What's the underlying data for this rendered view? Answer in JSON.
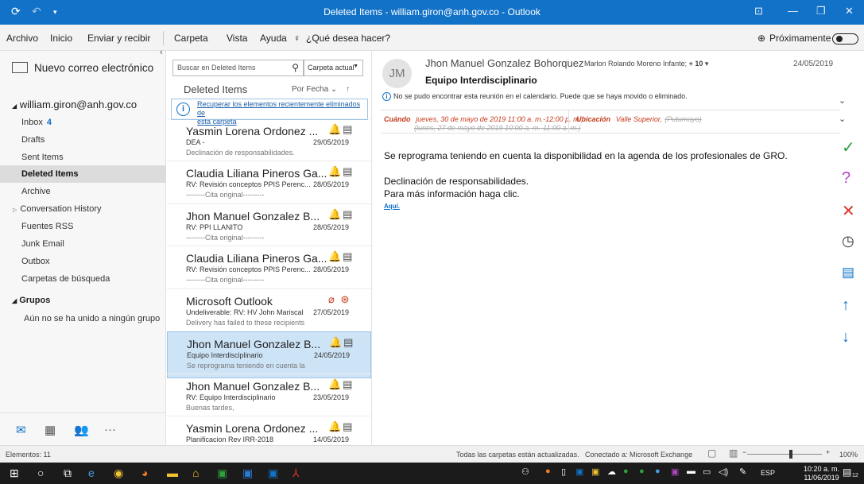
{
  "window": {
    "title": "Deleted Items - william.giron@anh.gov.co - Outlook"
  },
  "menu": {
    "items": [
      "Archivo",
      "Inicio",
      "Enviar y recibir",
      "Carpeta",
      "Vista",
      "Ayuda"
    ],
    "tell_me": "¿Qué desea hacer?",
    "coming_soon": "Próximamente"
  },
  "folders": {
    "new_mail": "Nuevo correo electrónico",
    "account": "william.giron@anh.gov.co",
    "items": [
      {
        "label": "Inbox",
        "count": "4"
      },
      {
        "label": "Drafts"
      },
      {
        "label": "Sent Items"
      },
      {
        "label": "Deleted Items"
      },
      {
        "label": "Archive"
      },
      {
        "label": "Conversation History"
      },
      {
        "label": "Fuentes RSS"
      },
      {
        "label": "Junk Email"
      },
      {
        "label": "Outbox"
      },
      {
        "label": "Carpetas de búsqueda"
      }
    ],
    "groups_label": "Grupos",
    "groups_empty": "Aún no se ha unido a ningún grupo"
  },
  "list": {
    "search_placeholder": "Buscar en Deleted Items",
    "scope": "Carpeta actual",
    "title": "Deleted Items",
    "sort": "Por Fecha",
    "recover_line1": "Recuperar los elementos recientemente eliminados de",
    "recover_line2": "esta carpeta",
    "messages": [
      {
        "from": "Yasmin Lorena Ordonez ...",
        "subject": "DEA -",
        "preview": "Declinación de responsabilidades.",
        "date": "29/05/2019"
      },
      {
        "from": "Claudia Liliana Pineros Ga...",
        "subject": "RV: Revisión conceptos PPIS Perenc...",
        "preview": "--------Cita original---------",
        "date": "28/05/2019"
      },
      {
        "from": "Jhon Manuel Gonzalez B...",
        "subject": "RV: PPI LLANITO",
        "preview": "--------Cita original---------",
        "date": "28/05/2019"
      },
      {
        "from": "Claudia Liliana Pineros Ga...",
        "subject": "RV: Revisión conceptos PPIS Perenc...",
        "preview": "--------Cita original---------",
        "date": "28/05/2019"
      },
      {
        "from": "Microsoft Outlook",
        "subject": "Undeliverable: RV: HV John Mariscal",
        "preview": "Delivery has failed to these recipients",
        "date": "27/05/2019"
      },
      {
        "from": "Jhon Manuel Gonzalez B...",
        "subject": "Equipo Interdisciplinario",
        "preview": "Se reprograma teniendo en cuenta la",
        "date": "24/05/2019"
      },
      {
        "from": "Jhon Manuel Gonzalez B...",
        "subject": "RV: Equipo Interdisciplinario",
        "preview": "Buenas tardes,",
        "date": "23/05/2019"
      },
      {
        "from": "Yasmin Lorena Ordonez ...",
        "subject": "Planificacion Rev IRR-2018",
        "preview": "",
        "date": "14/05/2019"
      }
    ]
  },
  "reading": {
    "initials": "JM",
    "sender": "Jhon Manuel Gonzalez Bohorquez",
    "to": "Marlon Rolando Moreno Infante;",
    "to_more": "+ 10",
    "date": "24/05/2019",
    "subject": "Equipo Interdisciplinario",
    "warning": "No se pudo encontrar esta reunión en el calendario. Puede que se haya movido o eliminado.",
    "when_label": "Cuándo",
    "when_value": "jueves, 30 de mayo de 2019 11:00 a. m.-12:00 p. m.,",
    "when_old": "(lunes, 27 de mayo de 2019 10:00 a. m.-11:00 a. m.)",
    "where_label": "Ubicación",
    "where_value": "Valle Superior,",
    "where_old": "(Putumayo)",
    "body_line1": "Se reprograma teniendo en cuenta la disponibilidad en la agenda de los profesionales de GRO.",
    "body_line2": "Declinación de responsabilidades.",
    "body_line3": "Para más información haga clic.",
    "body_link": "Aquí."
  },
  "status": {
    "items": "Elementos: 11",
    "sync": "Todas las carpetas están actualizadas.",
    "connection": "Conectado a: Microsoft Exchange",
    "zoom": "100%"
  },
  "taskbar": {
    "lang": "ESP",
    "time": "10:20 a. m.",
    "date": "11/06/2019",
    "notifications": "12"
  },
  "colors": {
    "accent": "#1272c7",
    "accept": "#2e9e3e",
    "tentative": "#b146c2",
    "decline": "#d9342b"
  }
}
